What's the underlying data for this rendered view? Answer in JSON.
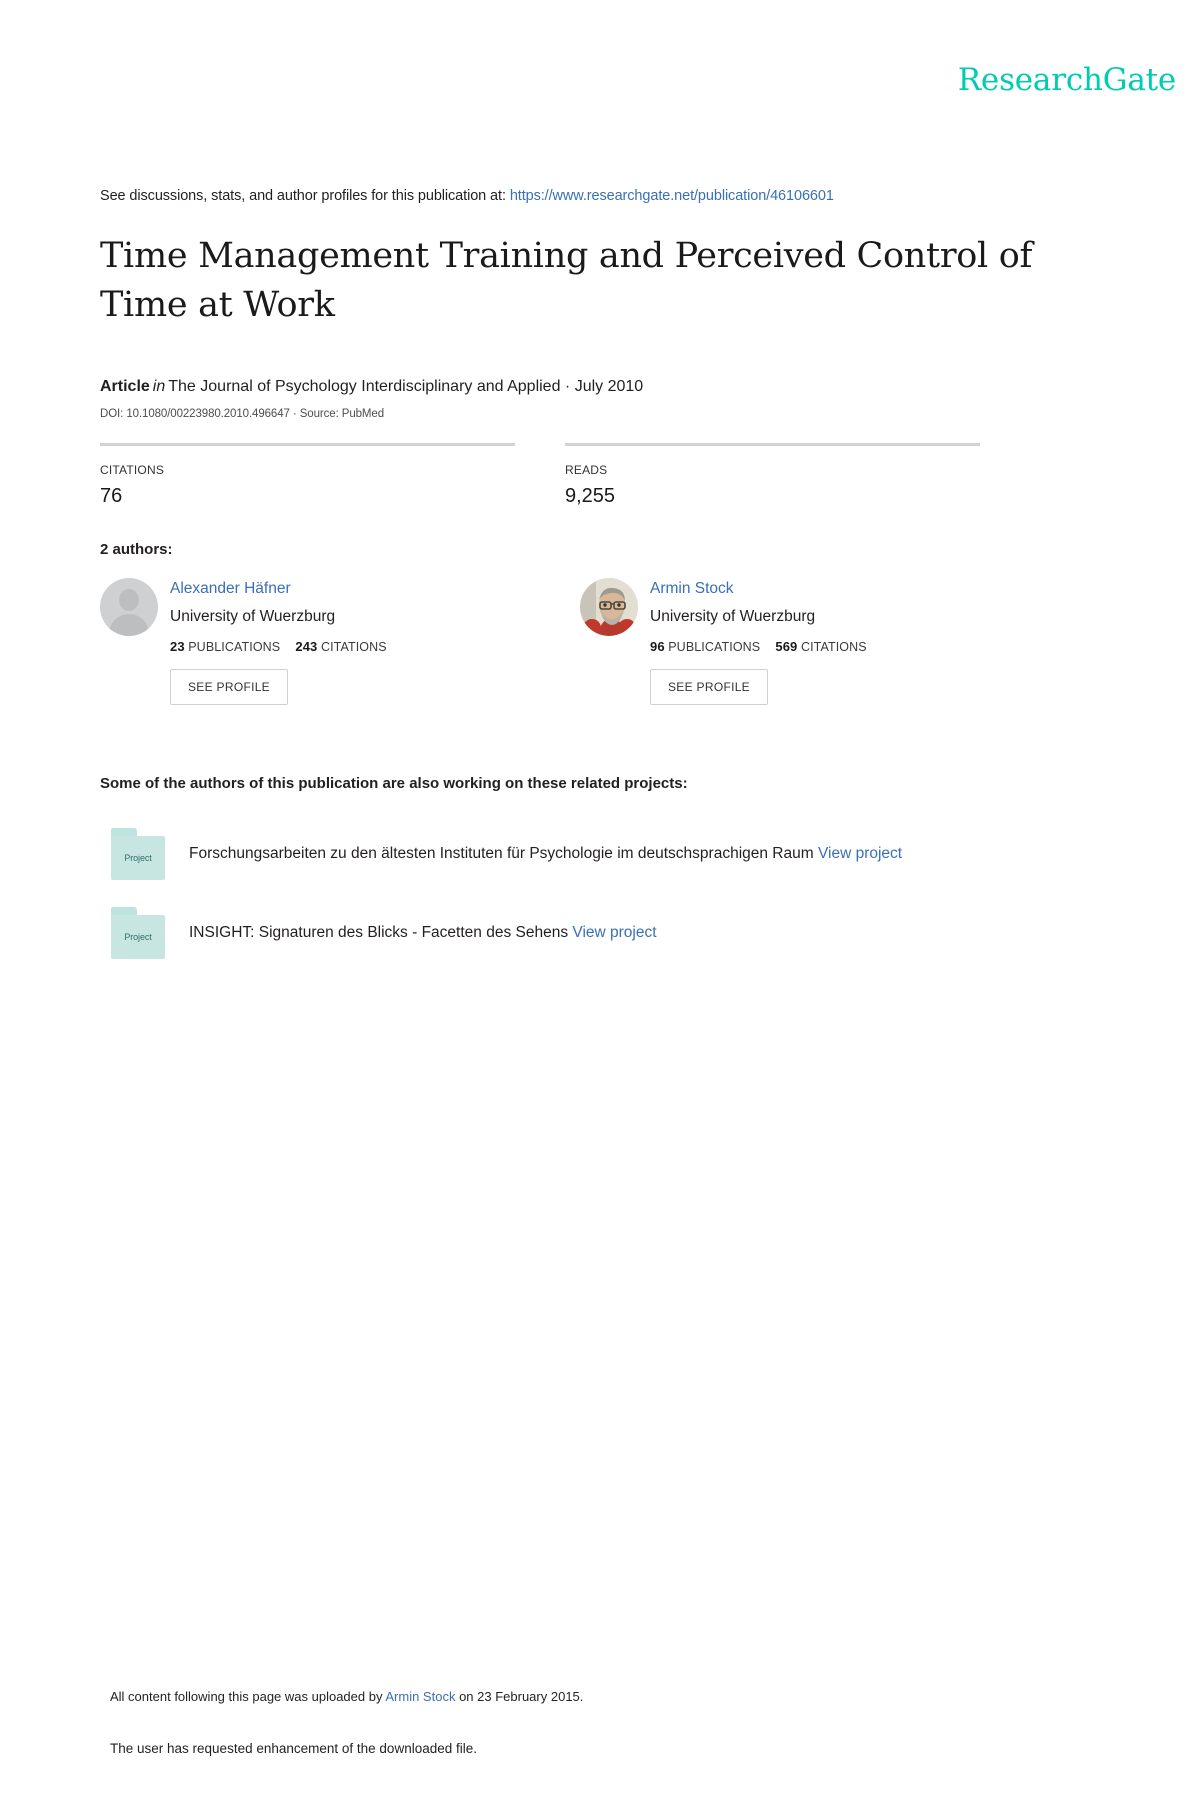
{
  "brand": {
    "logo_text": "ResearchGate",
    "logo_color": "#00ccb1",
    "link_color": "#3a6fb5"
  },
  "discussion": {
    "prefix": "See discussions, stats, and author profiles for this publication at:",
    "url": "https://www.researchgate.net/publication/46106601"
  },
  "publication": {
    "title": "Time Management Training and Perceived Control of Time at Work",
    "type": "Article",
    "in_word": "in",
    "venue": "The Journal of Psychology Interdisciplinary and Applied · July 2010",
    "doi_line": "DOI: 10.1080/00223980.2010.496647 · Source: PubMed"
  },
  "stats": [
    {
      "label": "CITATIONS",
      "value": "76"
    },
    {
      "label": "READS",
      "value": "9,255"
    }
  ],
  "authors_section": {
    "heading": "2 authors:",
    "see_profile_label": "SEE PROFILE",
    "publications_word": "PUBLICATIONS",
    "citations_word": "CITATIONS",
    "authors": [
      {
        "name": "Alexander Häfner",
        "affiliation": "University of Wuerzburg",
        "publications": "23",
        "citations": "243",
        "avatar_type": "placeholder"
      },
      {
        "name": "Armin Stock",
        "affiliation": "University of Wuerzburg",
        "publications": "96",
        "citations": "569",
        "avatar_type": "photo"
      }
    ]
  },
  "projects_section": {
    "heading": "Some of the authors of this publication are also working on these related projects:",
    "folder_label": "Project",
    "view_label": "View project",
    "projects": [
      {
        "title": "Forschungsarbeiten zu den ältesten Instituten für Psychologie im deutschsprachigen Raum"
      },
      {
        "title": "INSIGHT: Signaturen des Blicks - Facetten des Sehens"
      }
    ]
  },
  "footer": {
    "upload_prefix": "All content following this page was uploaded by",
    "uploader": "Armin Stock",
    "upload_suffix": "on 23 February 2015.",
    "note": "The user has requested enhancement of the downloaded file."
  }
}
